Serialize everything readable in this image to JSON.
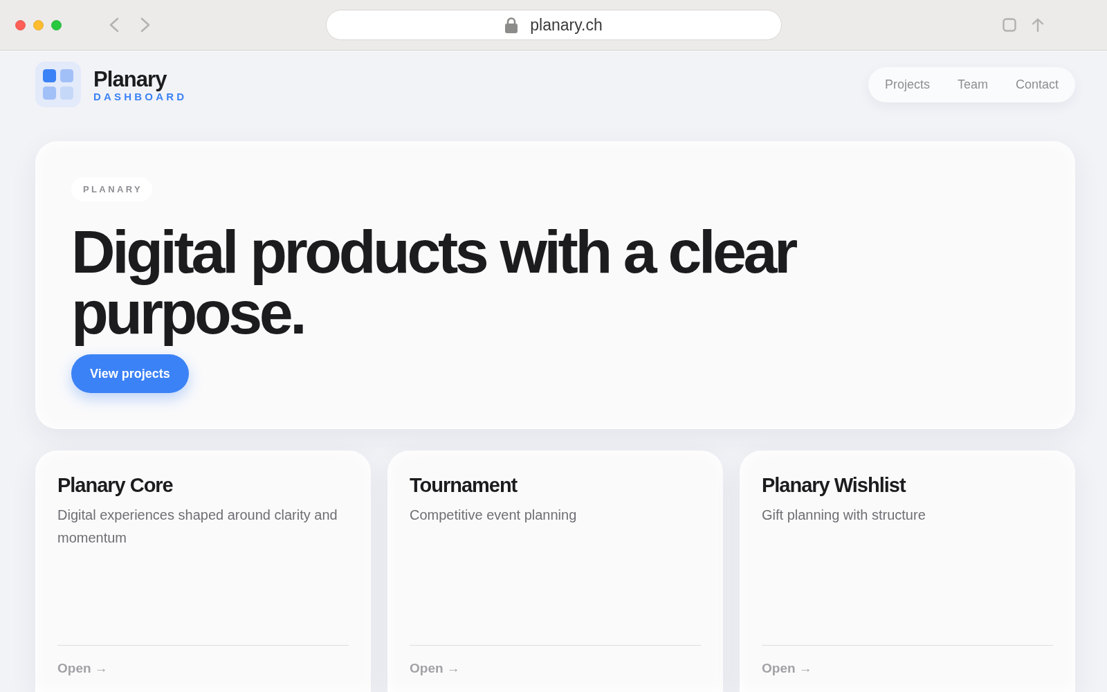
{
  "browser": {
    "url": "planary.ch"
  },
  "header": {
    "brand": {
      "name": "Planary",
      "tagline": "DASHBOARD"
    },
    "nav": [
      {
        "label": "Projects"
      },
      {
        "label": "Team"
      },
      {
        "label": "Contact"
      }
    ]
  },
  "hero": {
    "eyebrow": "PLANARY",
    "headline": "Digital products with a clear purpose.",
    "button": {
      "label": "View projects"
    }
  },
  "projects": [
    {
      "title": "Planary Core",
      "description": "Digital experiences shaped around clarity and momentum",
      "link": "Open →"
    },
    {
      "title": "Tournament",
      "description": "Competitive event planning",
      "link": "Open →"
    },
    {
      "title": "Planary Wishlist",
      "description": "Gift planning with structure",
      "link": "Open →"
    }
  ]
}
